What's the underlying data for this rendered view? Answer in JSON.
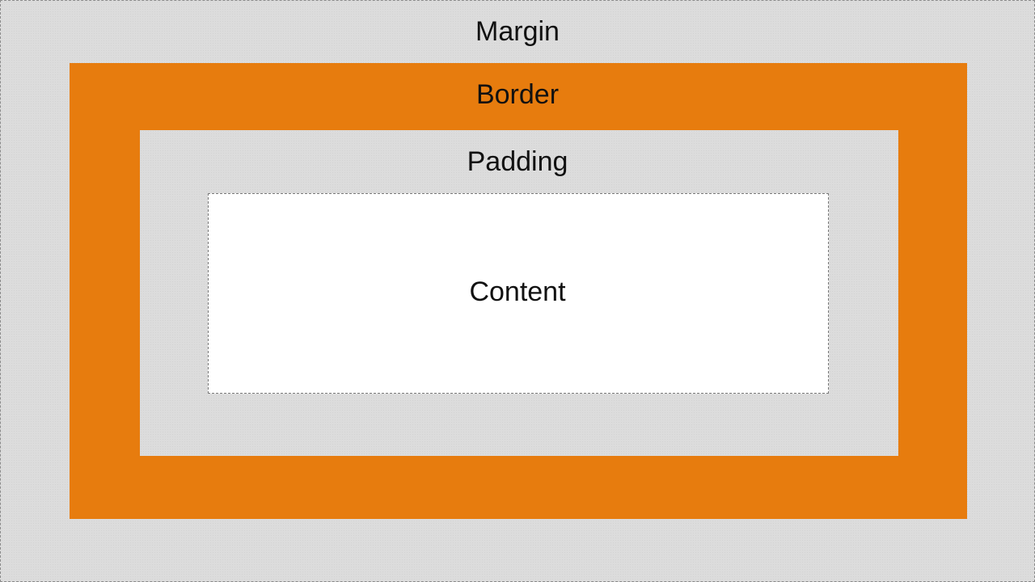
{
  "diagram": {
    "margin_label": "Margin",
    "border_label": "Border",
    "padding_label": "Padding",
    "content_label": "Content"
  },
  "colors": {
    "margin_fill": "#dcdcdc",
    "border_fill": "#e77c0e",
    "padding_fill": "#dcdcdc",
    "content_fill": "#ffffff",
    "text": "#111111"
  }
}
